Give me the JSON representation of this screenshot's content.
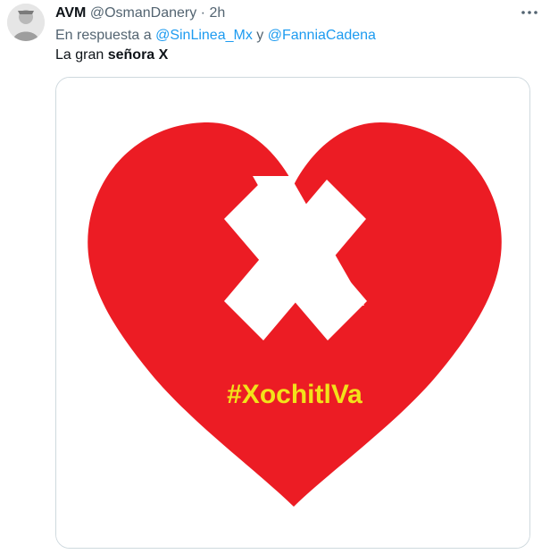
{
  "tweet": {
    "author": {
      "display_name": "AVM",
      "handle": "@OsmanDanery"
    },
    "separator": "·",
    "time": "2h",
    "reply_prefix": "En respuesta a",
    "reply_mentions": [
      "@SinLinea_Mx",
      "@FanniaCadena"
    ],
    "reply_joiner": "y",
    "text_plain": "La gran",
    "text_bold": "señora X",
    "media": {
      "hashtag": "#XochitlVa",
      "heart_color": "#ec1c24",
      "x_color": "#ffffff",
      "hashtag_color": "#f2e21a"
    }
  },
  "icons": {
    "more": "more-horizontal-icon",
    "avatar": "avatar"
  },
  "colors": {
    "text": "#0f1419",
    "secondary": "#536471",
    "link": "#1d9bf0",
    "border": "#cfd9de"
  }
}
